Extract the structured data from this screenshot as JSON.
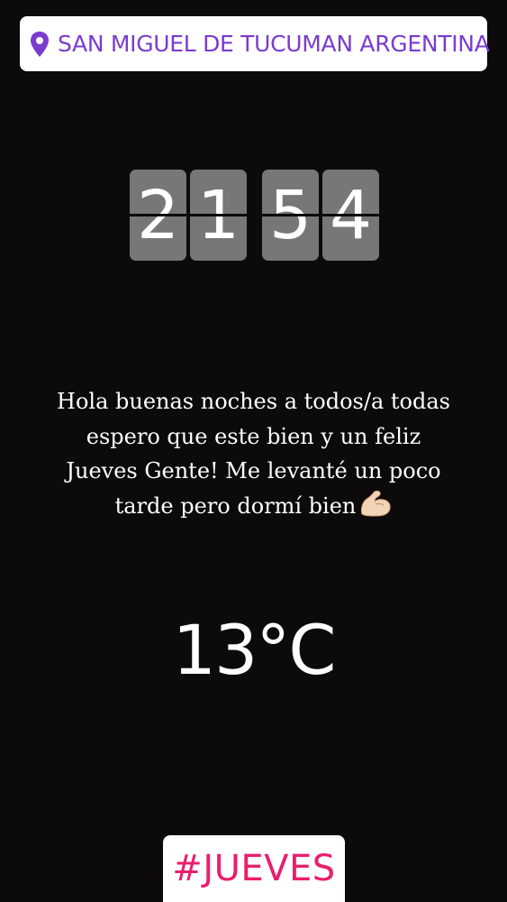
{
  "location": {
    "icon": "location-pin-icon",
    "text": "SAN MIGUEL DE TUCUMAN ARGENTINA",
    "color": "#7a3ccf"
  },
  "clock": {
    "digits": [
      "2",
      "1",
      "5",
      "4"
    ],
    "tile_color": "#777777"
  },
  "message": {
    "lines": [
      "Hola buenas noches a todos/a todas",
      "espero que este bien y un feliz",
      "Jueves Gente! Me levanté un poco",
      "tarde pero dormí bien"
    ],
    "emoji": "flexed-biceps-icon"
  },
  "temperature": {
    "text": "13°C"
  },
  "hashtag": {
    "text": "#JUEVES",
    "color": "#ea1e6e"
  }
}
